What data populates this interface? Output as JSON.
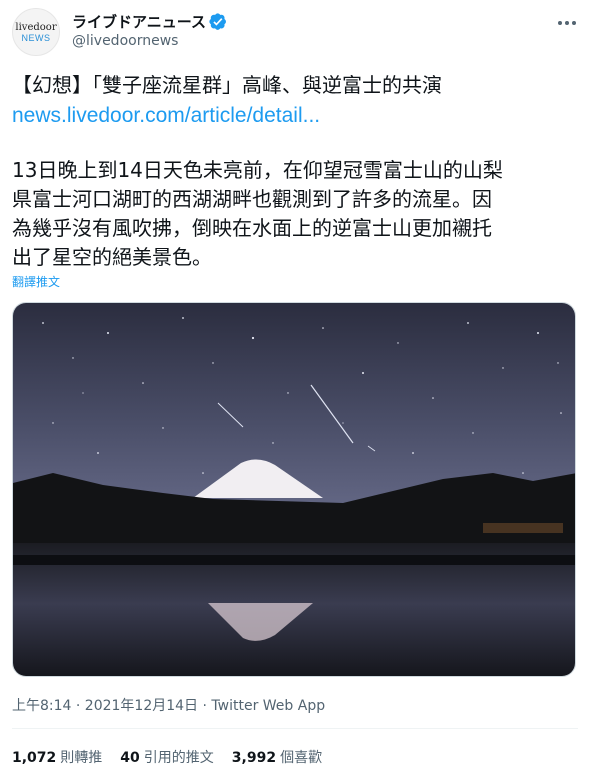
{
  "account": {
    "avatar_line1": "livedoor",
    "avatar_line2": "NEWS",
    "display_name": "ライブドアニュース",
    "handle": "@livedoornews"
  },
  "tweet": {
    "headline": "【幻想】「雙子座流星群」高峰、與逆富士的共演",
    "link": "news.livedoor.com/article/detail...",
    "body_lines": [
      "13日晚上到14日天色未亮前，在仰望冠雪富士山的山梨",
      "県富士河口湖町的西湖湖畔也觀測到了許多的流星。因",
      "為幾乎沒有風吹拂，倒映在水面上的逆富士山更加襯托",
      "出了星空的絕美景色。"
    ],
    "translate_label": "翻譯推文",
    "timestamp": "上午8:14 · 2021年12月14日 · Twitter Web App"
  },
  "stats": {
    "retweets_count": "1,072",
    "retweets_label": "則轉推",
    "quotes_count": "40",
    "quotes_label": "引用的推文",
    "likes_count": "3,992",
    "likes_label": "個喜歡"
  },
  "icons": {
    "verified": "verified-badge-icon",
    "more": "more-options-icon"
  },
  "colors": {
    "link": "#1d9bf0",
    "secondary_text": "#536471",
    "primary_text": "#0f1419"
  }
}
